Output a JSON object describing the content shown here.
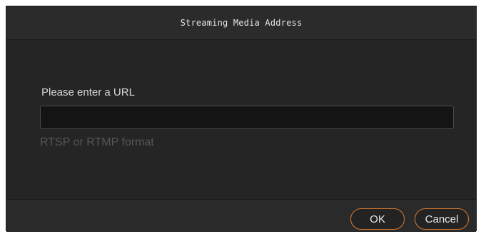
{
  "dialog": {
    "title": "Streaming Media Address",
    "url_label": "Please enter a URL",
    "url_value": "",
    "url_hint": "RTSP or RTMP format",
    "ok_label": "OK",
    "cancel_label": "Cancel"
  },
  "colors": {
    "accent": "#d87a2f",
    "background": "#252525"
  }
}
